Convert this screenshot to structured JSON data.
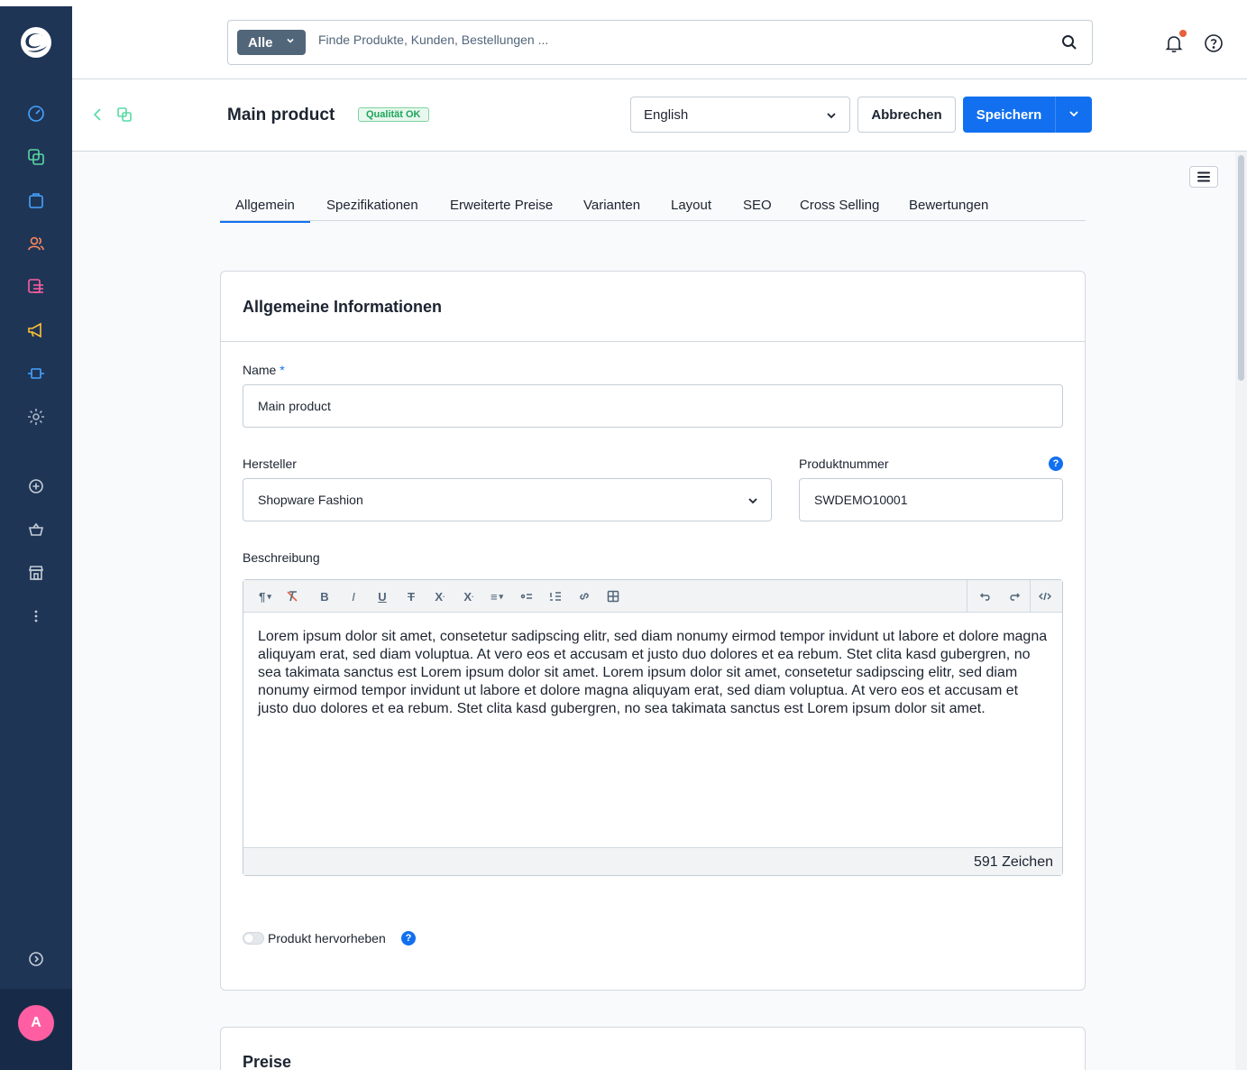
{
  "header": {
    "search_type": "Alle",
    "search_placeholder": "Finde Produkte, Kunden, Bestellungen ..."
  },
  "smartbar": {
    "title": "Main product",
    "quality_badge": "Qualität OK",
    "language": "English",
    "cancel_label": "Abbrechen",
    "save_label": "Speichern"
  },
  "tabs": [
    {
      "label": "Allgemein",
      "active": true
    },
    {
      "label": "Spezifikationen",
      "active": false
    },
    {
      "label": "Erweiterte Preise",
      "active": false
    },
    {
      "label": "Varianten",
      "active": false
    },
    {
      "label": "Layout",
      "active": false
    },
    {
      "label": "SEO",
      "active": false
    },
    {
      "label": "Cross Selling",
      "active": false
    },
    {
      "label": "Bewertungen",
      "active": false
    }
  ],
  "general_card": {
    "title": "Allgemeine Informationen",
    "name_label": "Name",
    "name_required": "*",
    "name_value": "Main product",
    "manufacturer_label": "Hersteller",
    "manufacturer_value": "Shopware Fashion",
    "product_number_label": "Produktnummer",
    "product_number_value": "SWDEMO10001",
    "description_label": "Beschreibung",
    "description_text": "Lorem ipsum dolor sit amet, consetetur sadipscing elitr, sed diam nonumy eirmod tempor invidunt ut labore et dolore magna aliquyam erat, sed diam voluptua. At vero eos et accusam et justo duo dolores et ea rebum. Stet clita kasd gubergren, no sea takimata sanctus est Lorem ipsum dolor sit amet. Lorem ipsum dolor sit amet, consetetur sadipscing elitr, sed diam nonumy eirmod tempor invidunt ut labore et dolore magna aliquyam erat, sed diam voluptua. At vero eos et accusam et justo duo dolores et ea rebum. Stet clita kasd gubergren, no sea takimata sanctus est Lorem ipsum dolor sit amet.",
    "char_count": "591 Zeichen",
    "highlight_label": "Produkt hervorheben"
  },
  "prices_card": {
    "title": "Preise"
  },
  "user": {
    "initial": "A"
  },
  "info_mark": "?",
  "colors": {
    "sidebar": "#1f3556",
    "primary": "#1270f0",
    "avatar": "#ff5fa2",
    "badge_green": "#1fa55a",
    "notification_dot": "#e8603c"
  },
  "icons": {
    "nav": [
      "dashboard-icon",
      "products-icon",
      "orders-icon",
      "customers-icon",
      "content-icon",
      "marketing-icon",
      "extensions-icon",
      "settings-icon",
      "add-sales-channel-icon",
      "basket-icon",
      "storefront-icon",
      "more-icon",
      "expand-icon"
    ]
  }
}
